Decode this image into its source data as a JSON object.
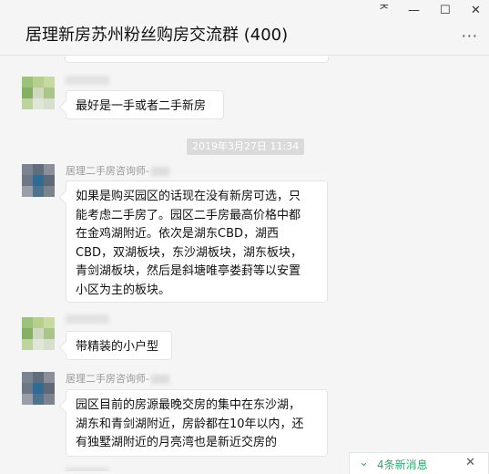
{
  "header": {
    "title": "居理新房苏州粉丝购房交流群 (400)",
    "pin_glyph": "ᅎ",
    "minimize_glyph": "—",
    "maximize_glyph": "☐",
    "close_glyph": "✕",
    "more_glyph": "···"
  },
  "messages": [
    {
      "text": "最好是一手或者二手新房"
    },
    {
      "sender": "居理二手房咨询师-",
      "text_lines": [
        "如果是购买园区的话现在没有新房可选，只",
        "能考虑二手房了。园区二手房最高价格中都",
        "在金鸡湖附近。依次是湖东CBD，湖西",
        "CBD，双湖板块，东沙湖板块，湖东板块，",
        "青剑湖板块，然后是斜塘唯亭娄葑等以安置",
        "小区为主的板块。"
      ]
    },
    {
      "text": "带精装的小户型"
    },
    {
      "sender": "居理二手房咨询师-",
      "text_lines": [
        "园区目前的房源最晚交房的集中在东沙湖，",
        "湖东和青剑湖附近，房龄都在10年以内，还",
        "有独墅湖附近的月亮湾也是新近交房的"
      ]
    }
  ],
  "timestamp": "2019年3月27日 11:34",
  "new_messages": {
    "chevron_glyph": "⌄",
    "label": "4条新消息",
    "close_glyph": "✕"
  },
  "colors": {
    "accent": "#2aae67",
    "timestamp_bg": "#dadada"
  }
}
